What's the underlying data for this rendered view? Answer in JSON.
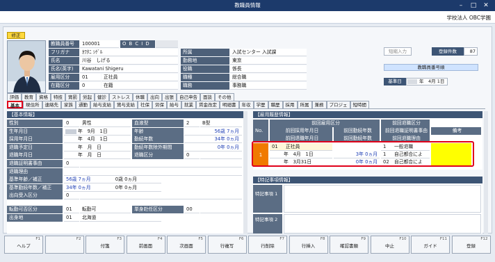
{
  "window": {
    "title": "教職員情報",
    "btn_min": "–",
    "btn_max": "□",
    "btn_close": "✕"
  },
  "company": "学校法人 OBC学園",
  "badge": "修正",
  "profile": {
    "rows": [
      {
        "label": "教職員番号",
        "value": "100001",
        "extra": "O B C I D"
      },
      {
        "label": "フリガナ",
        "value": "ｶﾜﾀﾆ ｼｹﾞﾙ"
      },
      {
        "label": "氏名",
        "value": "川谷　しげる"
      },
      {
        "label": "氏名(英字)",
        "value": "Kawatani Shigeru"
      },
      {
        "label": "雇用区分",
        "code": "01",
        "value": "正社員"
      },
      {
        "label": "在籍区分",
        "code": "0",
        "value": "在籍"
      }
    ],
    "right_rows": [
      {
        "label": "所属",
        "value": "入試センター 入試課"
      },
      {
        "label": "勤務地",
        "value": "東京"
      },
      {
        "label": "役職",
        "value": "係長"
      },
      {
        "label": "職種",
        "value": "総合職"
      },
      {
        "label": "職務",
        "value": "事務職"
      }
    ]
  },
  "side": {
    "input_btn": "短縮入力",
    "count_label": "登録件数",
    "count": "87",
    "staffno_label": "教職員番号順",
    "kijun_label": "基準日",
    "kijun_value": "年　4月 1日"
  },
  "tabs_row1": [
    "評価",
    "教育",
    "資格",
    "特技",
    "賞罰",
    "労起",
    "健診",
    "ストレス",
    "休職",
    "出向",
    "出張",
    "自己申告",
    "面談",
    "その他"
  ],
  "tabs_row2": [
    "基本",
    "現住所",
    "連絡先",
    "家族",
    "通勤",
    "給与支給",
    "賞与支給",
    "社保",
    "労保",
    "給与",
    "就業",
    "賃金改定",
    "明細書",
    "年収",
    "学歴",
    "職歴",
    "採用",
    "所属",
    "兼務",
    "プロジェ",
    "短時間"
  ],
  "basic": {
    "head": "【基本情報】",
    "rows": [
      {
        "l": "性別",
        "code": "0",
        "v": "男性",
        "l2": "血液型",
        "code2": "2",
        "v2": "B型"
      },
      {
        "l": "生年月日",
        "v": "年　9月　1日",
        "l2": "年齢",
        "v2": "56歳 7ヵ月"
      },
      {
        "l": "採用年月日",
        "v": "年　4月　1日",
        "l2": "勤続年数",
        "v2": "34年 0ヵ月"
      },
      {
        "l": "退職予定日",
        "v": "年　月　日",
        "l2": "勤続年数除外期間",
        "v2": "0年 0ヵ月"
      },
      {
        "l": "退職年月日",
        "v": "年　月　日",
        "l2": "退職区分",
        "code2": "0"
      },
      {
        "l": "退職証明書事由",
        "code": "0"
      },
      {
        "l": "退職理由"
      },
      {
        "l": "基準年齢／補正",
        "v": "56歳 7ヵ月",
        "v3": "0歳 0ヵ月"
      },
      {
        "l": "基準勤続年数／補正",
        "v": "34年 0ヵ月",
        "v3": "0年 0ヵ月"
      },
      {
        "l": "出向受入区分",
        "code": "0"
      },
      {
        "l": "転勤可否区分",
        "code": "01",
        "v": "転勤可",
        "l2": "単身赴任区分",
        "code2": "00"
      },
      {
        "l": "出身地",
        "code": "01",
        "v": "北海道"
      }
    ]
  },
  "employment": {
    "head": "【雇用履歴情報】",
    "col_no": "No.",
    "h1": [
      "前回雇用区分",
      "",
      "前回退職区分"
    ],
    "h2": [
      "前回採用年月日",
      "前回勤続年数",
      "前回退職証明書事由",
      "備考"
    ],
    "h3": [
      "前回退職年月日",
      "前回勤続年数",
      "前回退職理由"
    ],
    "row": {
      "no": "1",
      "type_code": "01",
      "type": "正社員",
      "hire": "年　4月　1日",
      "tenure1": "3年 0ヵ月",
      "retire_code": "1",
      "retire": "一般退職",
      "retire_date": "年　3月31日",
      "tenure2": "0年 0ヵ月",
      "reason_code": "1",
      "reason": "自己都合によ",
      "reason_code2": "02",
      "reason2": "自己都合によ"
    }
  },
  "special": {
    "head": "【特記事項情報】",
    "item1": "特記事項 1",
    "item2": "特記事項 2"
  },
  "fkeys": [
    {
      "k": "F1",
      "n": "ヘルプ"
    },
    {
      "k": "F2",
      "n": ""
    },
    {
      "k": "F3",
      "n": "付箋"
    },
    {
      "k": "F4",
      "n": "前画面"
    },
    {
      "k": "F5",
      "n": "次画面"
    },
    {
      "k": "F6",
      "n": "行複写"
    },
    {
      "k": "F7",
      "n": "行削除"
    },
    {
      "k": "F8",
      "n": "行挿入"
    },
    {
      "k": "F9",
      "n": "確認書類"
    },
    {
      "k": "F10",
      "n": "中止"
    },
    {
      "k": "F11",
      "n": "ガイド"
    },
    {
      "k": "F12",
      "n": "登録"
    }
  ]
}
